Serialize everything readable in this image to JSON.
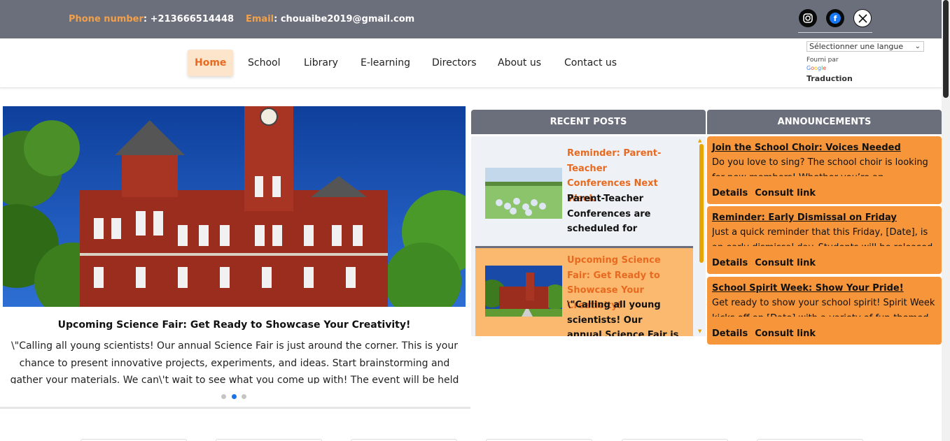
{
  "topbar": {
    "phone_label": "Phone number",
    "phone_value": ": +213666514448",
    "email_label": "Email",
    "email_value": ": chouaibe2019@gmail.com",
    "social": [
      {
        "name": "instagram-icon",
        "glyph": "◎"
      },
      {
        "name": "facebook-icon",
        "glyph": "f"
      },
      {
        "name": "x-twitter-icon",
        "glyph": "𝕏"
      }
    ]
  },
  "nav": {
    "items": [
      "Home",
      "School",
      "Library",
      "E-learning",
      "Directors",
      "About us",
      "Contact us"
    ],
    "active": "Home"
  },
  "translate": {
    "select_value": "Sélectionner une langue",
    "powered_by": "Fourni par",
    "google": "Google",
    "traduction": "Traduction"
  },
  "slider": {
    "title": "Upcoming Science Fair: Get Ready to Showcase Your Creativity!",
    "text": "\\\"Calling all young scientists! Our annual Science Fair is just around the corner. This is your chance to present innovative projects, experiments, and ideas. Start brainstorming and gather your materials. We can\\'t wait to see what you come up with! The event will be held",
    "dots": 3,
    "active_dot": 2
  },
  "recent_posts": {
    "heading": "RECENT POSTS",
    "posts": [
      {
        "title": "Reminder: Parent-Teacher Conferences Next Week",
        "body": "Parent-Teacher Conferences are scheduled for [Dates]. This is a valuable"
      },
      {
        "title": "Upcoming Science Fair: Get Ready to Showcase Your Creativity!",
        "body": "\\\"Calling all young scientists! Our annual Science Fair is just"
      }
    ]
  },
  "announcements": {
    "heading": "ANNOUNCEMENTS",
    "details_label": "Details",
    "consult_label": "Consult link",
    "items": [
      {
        "title": "Join the School Choir: Voices Needed",
        "body": "Do you love to sing? The school choir is looking for new members! Whether you’re an"
      },
      {
        "title": "Reminder: Early Dismissal on Friday",
        "body": "Just a quick reminder that this Friday, [Date], is an early dismissal day. Students will be released"
      },
      {
        "title": "School Spirit Week: Show Your Pride!",
        "body": "Get ready to show your school spirit! Spirit Week kicks off on [Date] with a variety of fun-themed"
      }
    ]
  },
  "colors": {
    "topbar": "#6b6f7b",
    "accent_orange": "#e86a20",
    "announcement_bg": "#f7953a",
    "post_highlight": "#fbb96f"
  }
}
